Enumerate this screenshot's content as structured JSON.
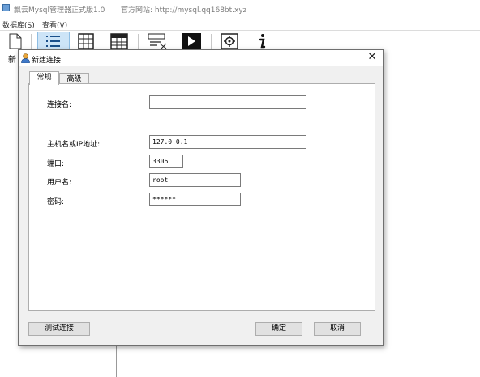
{
  "app": {
    "title": "飘云Mysql管理器正式版1.0",
    "site_label": "官方网站: http://mysql.qq168bt.xyz"
  },
  "menu": [
    {
      "label": "数据库(S)"
    },
    {
      "label": "查看(V)"
    }
  ],
  "toolbar": {
    "items": [
      "new-document",
      "list",
      "table-grid",
      "table-header-grid",
      "sql-editor",
      "run",
      "settings",
      "info"
    ],
    "peek_label": "新"
  },
  "dialog": {
    "title": "新建连接",
    "close_glyph": "✕",
    "tabs": [
      {
        "label": "常规",
        "active": true
      },
      {
        "label": "高级",
        "active": false
      }
    ],
    "fields": {
      "connection_name": {
        "label": "连接名:",
        "value": ""
      },
      "host": {
        "label": "主机名或IP地址:",
        "value": "127.0.0.1"
      },
      "port": {
        "label": "端口:",
        "value": "3306"
      },
      "user": {
        "label": "用户名:",
        "value": "root"
      },
      "password": {
        "label": "密码:",
        "value": "******"
      }
    },
    "buttons": {
      "test": "测试连接",
      "ok": "确定",
      "cancel": "取消"
    }
  },
  "colors": {
    "active_toolbar_bg": "#cde4f7",
    "active_toolbar_border": "#8ebde3",
    "dialog_bg": "#f0f0f0"
  }
}
